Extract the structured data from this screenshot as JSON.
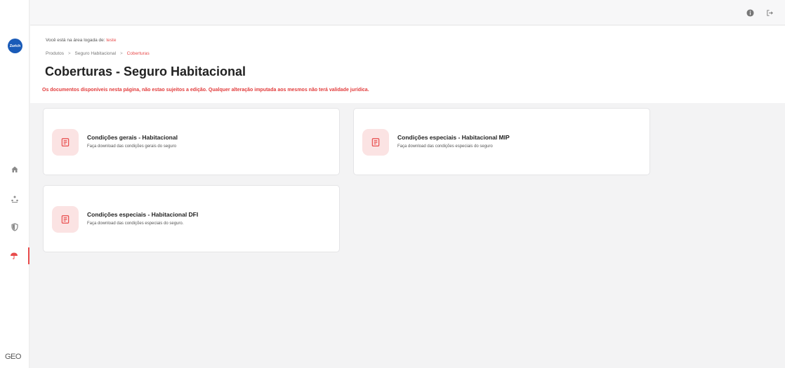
{
  "sidebar": {
    "logo_text": "Zurich",
    "items": [
      {
        "name": "home",
        "icon": "home-icon"
      },
      {
        "name": "users",
        "icon": "users-icon"
      },
      {
        "name": "shield",
        "icon": "shield-icon"
      },
      {
        "name": "umbrella",
        "icon": "umbrella-icon",
        "active": true
      }
    ],
    "footer_text": "GEO"
  },
  "topbar": {
    "icons": [
      "info-icon",
      "logout-icon"
    ]
  },
  "header": {
    "logged_prefix": "Você está na área logada de: ",
    "logged_user": "teste",
    "breadcrumb": [
      "Produtos",
      "Seguro Habitacional",
      "Coberturas"
    ],
    "breadcrumb_sep": ">",
    "title": "Coberturas - Seguro Habitacional",
    "warning": "Os documentos disponíveis nesta página, não estao sujeitos a edição. Qualquer alteração imputada aos mesmos não terá validade jurídica."
  },
  "cards": [
    {
      "title": "Condições gerais - Habitacional",
      "desc": "Faça download das condições gerais do seguro",
      "icon": "document-icon"
    },
    {
      "title": "Condições especiais - Habitacional MIP",
      "desc": "Faça download das condições especiais do seguro",
      "icon": "document-icon"
    },
    {
      "title": "Condições especiais - Habitacional DFI",
      "desc": "Faça download das condições especiais do seguro.",
      "icon": "document-icon"
    }
  ],
  "colors": {
    "accent": "#e84b4b",
    "logo_blue": "#1a5bb8",
    "icon_bg": "#fbe3e3"
  }
}
